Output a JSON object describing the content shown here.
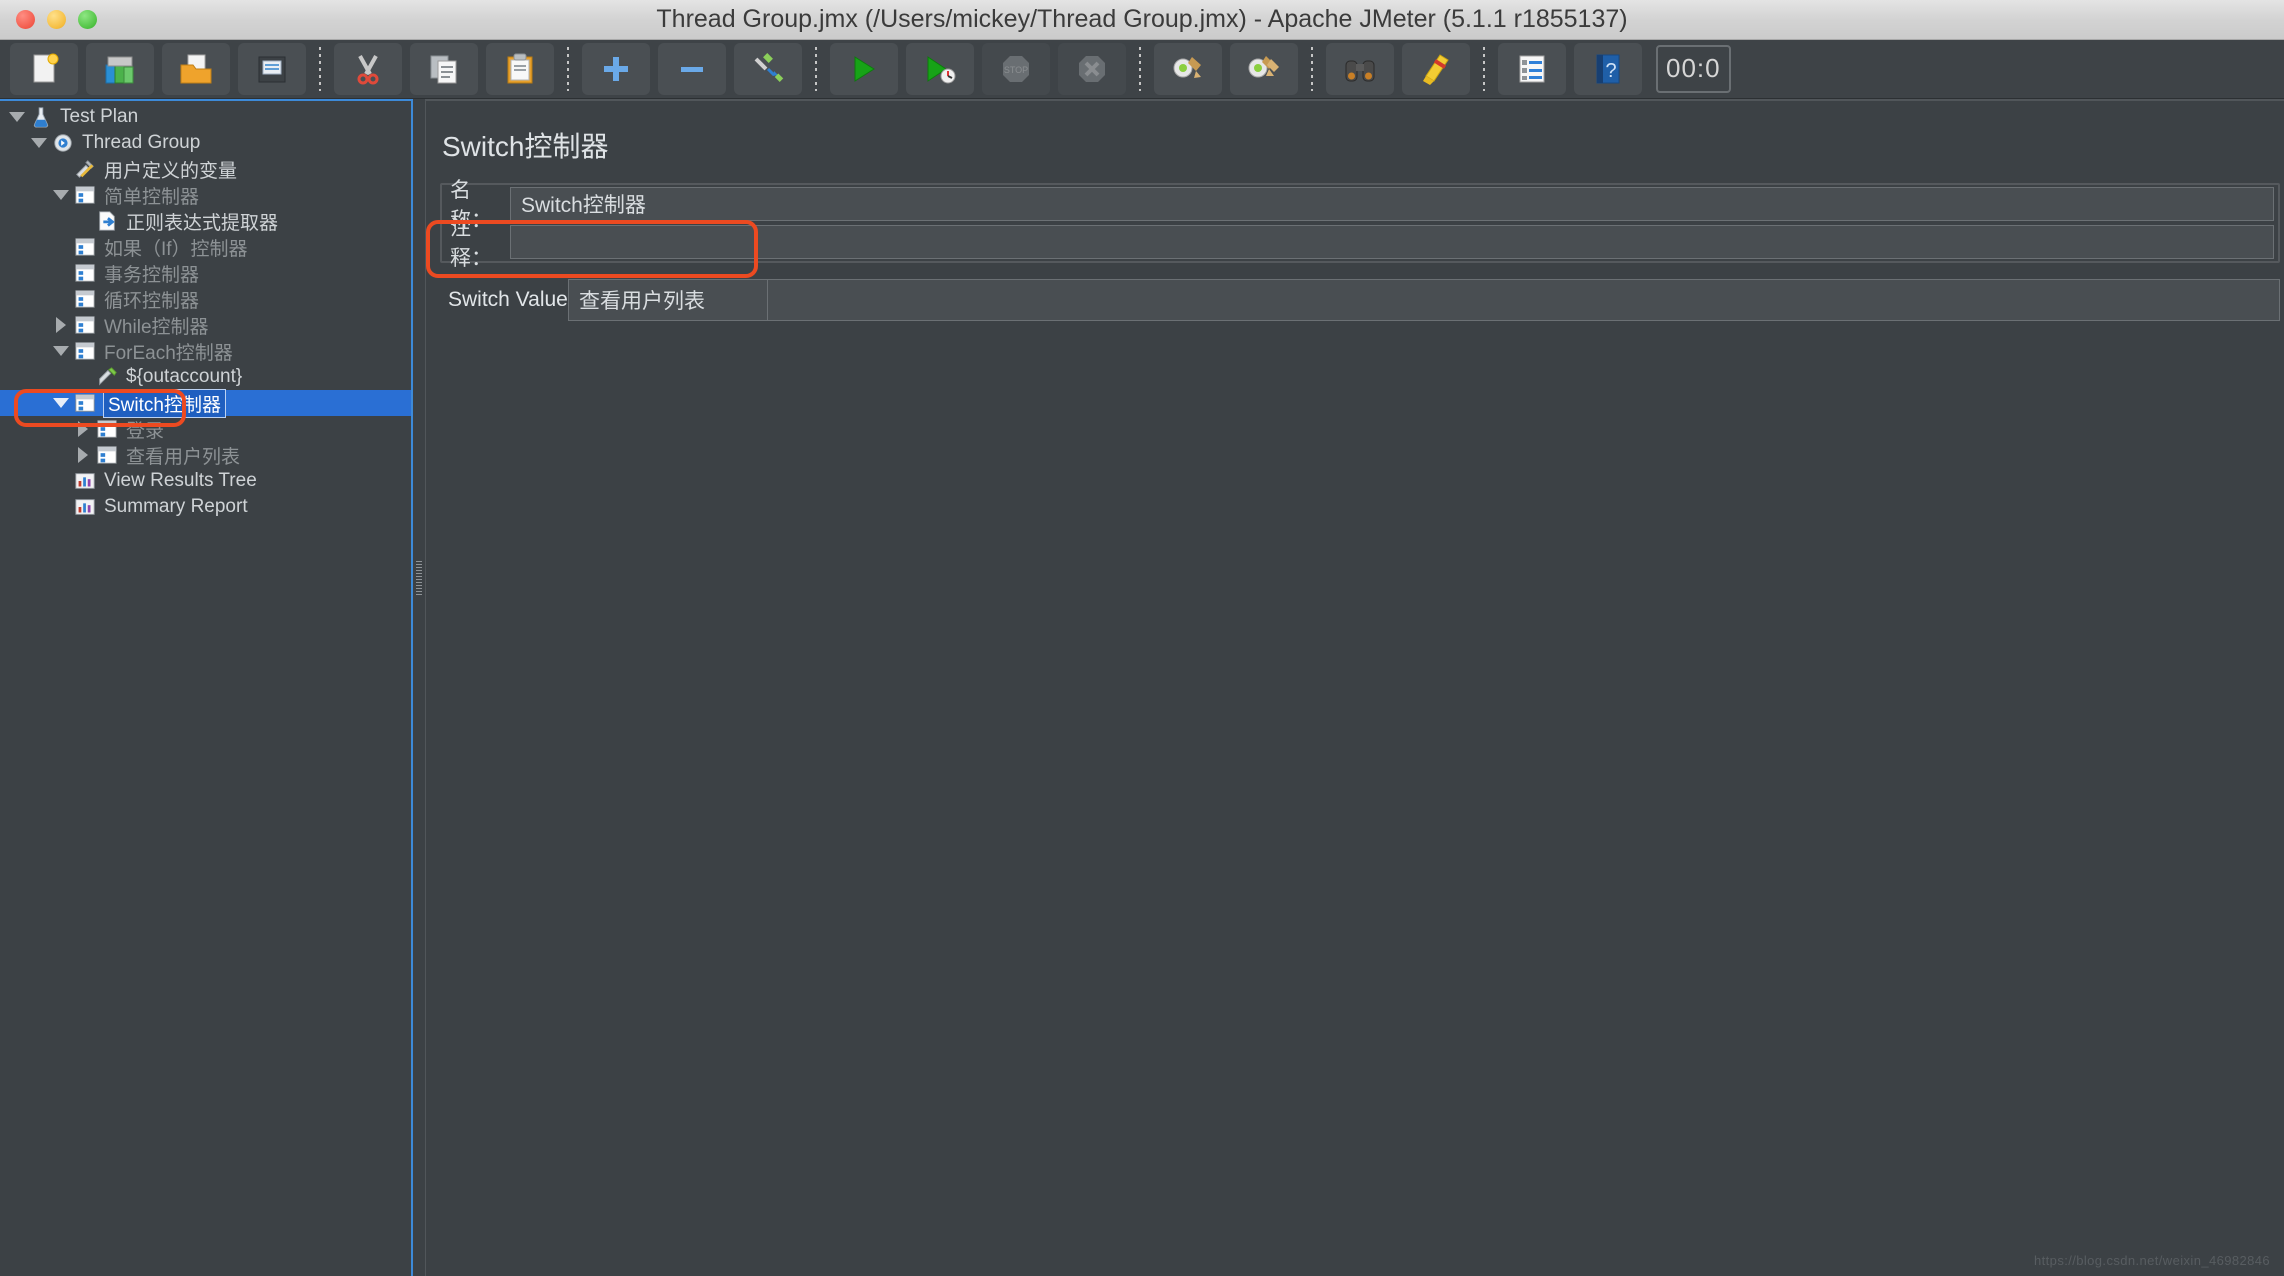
{
  "window": {
    "title": "Thread Group.jmx (/Users/mickey/Thread Group.jmx) - Apache JMeter (5.1.1 r1855137)",
    "controls": {
      "close": "close",
      "minimize": "minimize",
      "maximize": "maximize"
    }
  },
  "toolbar": {
    "timer": "00:0",
    "buttons": [
      {
        "name": "new-button",
        "icon": "new-file-icon",
        "disabled": false
      },
      {
        "name": "templates-button",
        "icon": "templates-icon",
        "disabled": false
      },
      {
        "name": "open-button",
        "icon": "open-folder-icon",
        "disabled": false
      },
      {
        "name": "save-button",
        "icon": "save-disk-icon",
        "disabled": false
      },
      {
        "name": "separator-1",
        "icon": "separator",
        "disabled": false
      },
      {
        "name": "cut-button",
        "icon": "scissors-icon",
        "disabled": false
      },
      {
        "name": "copy-button",
        "icon": "copy-icon",
        "disabled": false
      },
      {
        "name": "paste-button",
        "icon": "clipboard-icon",
        "disabled": false
      },
      {
        "name": "separator-2",
        "icon": "separator",
        "disabled": false
      },
      {
        "name": "expand-all-button",
        "icon": "plus-icon",
        "disabled": false
      },
      {
        "name": "collapse-all-button",
        "icon": "minus-icon",
        "disabled": false
      },
      {
        "name": "toggle-button",
        "icon": "toggle-pencil-icon",
        "disabled": false
      },
      {
        "name": "separator-3",
        "icon": "separator",
        "disabled": false
      },
      {
        "name": "start-button",
        "icon": "play-green-icon",
        "disabled": false
      },
      {
        "name": "start-no-pause-button",
        "icon": "play-nopause-icon",
        "disabled": false
      },
      {
        "name": "stop-button",
        "icon": "stop-icon",
        "disabled": true
      },
      {
        "name": "shutdown-button",
        "icon": "shutdown-x-icon",
        "disabled": true
      },
      {
        "name": "separator-4",
        "icon": "separator",
        "disabled": false
      },
      {
        "name": "clear-button",
        "icon": "gear-broom-icon",
        "disabled": false
      },
      {
        "name": "clear-all-button",
        "icon": "gear-brooms-icon",
        "disabled": false
      },
      {
        "name": "separator-5",
        "icon": "separator",
        "disabled": false
      },
      {
        "name": "search-button",
        "icon": "binoculars-icon",
        "disabled": false
      },
      {
        "name": "reset-search-button",
        "icon": "broom-yellow-icon",
        "disabled": false
      },
      {
        "name": "separator-6",
        "icon": "separator",
        "disabled": false
      },
      {
        "name": "function-helper-button",
        "icon": "function-list-icon",
        "disabled": false
      },
      {
        "name": "help-button",
        "icon": "help-book-icon",
        "disabled": false
      }
    ]
  },
  "tree": {
    "nodes": [
      {
        "label": "Test Plan",
        "indent": 0,
        "twisty": "down",
        "icon": "test-plan-icon",
        "dim": false,
        "selected": false
      },
      {
        "label": "Thread Group",
        "indent": 1,
        "twisty": "down",
        "icon": "thread-group-icon",
        "dim": false,
        "selected": false
      },
      {
        "label": "用户定义的变量",
        "indent": 2,
        "twisty": "none",
        "icon": "user-vars-icon",
        "dim": false,
        "selected": false
      },
      {
        "label": "简单控制器",
        "indent": 2,
        "twisty": "down",
        "icon": "controller-icon",
        "dim": true,
        "selected": false
      },
      {
        "label": "正则表达式提取器",
        "indent": 3,
        "twisty": "none",
        "icon": "extractor-icon",
        "dim": false,
        "selected": false
      },
      {
        "label": "如果（If）控制器",
        "indent": 2,
        "twisty": "none",
        "icon": "controller-icon",
        "dim": true,
        "selected": false
      },
      {
        "label": "事务控制器",
        "indent": 2,
        "twisty": "none",
        "icon": "controller-icon",
        "dim": true,
        "selected": false
      },
      {
        "label": "循环控制器",
        "indent": 2,
        "twisty": "none",
        "icon": "controller-icon",
        "dim": true,
        "selected": false
      },
      {
        "label": "While控制器",
        "indent": 2,
        "twisty": "right",
        "icon": "controller-icon",
        "dim": true,
        "selected": false
      },
      {
        "label": "ForEach控制器",
        "indent": 2,
        "twisty": "down",
        "icon": "controller-icon",
        "dim": true,
        "selected": false
      },
      {
        "label": "${outaccount}",
        "indent": 3,
        "twisty": "none",
        "icon": "sampler-icon",
        "dim": false,
        "selected": false
      },
      {
        "label": "Switch控制器",
        "indent": 2,
        "twisty": "down",
        "icon": "controller-icon",
        "dim": false,
        "selected": true
      },
      {
        "label": "登录",
        "indent": 3,
        "twisty": "right",
        "icon": "controller-icon",
        "dim": true,
        "selected": false
      },
      {
        "label": "查看用户列表",
        "indent": 3,
        "twisty": "right",
        "icon": "controller-icon",
        "dim": true,
        "selected": false
      },
      {
        "label": "View Results Tree",
        "indent": 2,
        "twisty": "none",
        "icon": "listener-icon",
        "dim": false,
        "selected": false
      },
      {
        "label": "Summary Report",
        "indent": 2,
        "twisty": "none",
        "icon": "listener-icon",
        "dim": false,
        "selected": false
      }
    ]
  },
  "detail": {
    "title": "Switch控制器",
    "name_label": "名称：",
    "name_value": "Switch控制器",
    "comment_label": "注释：",
    "comment_value": "",
    "switch_value_label": "Switch Value",
    "switch_value": "查看用户列表"
  },
  "watermark": {
    "text": "https://blog.csdn.net/weixin_46982846"
  },
  "colors": {
    "accent_selection": "#2a6fd4",
    "annotation_red": "#ec4a21",
    "pane_bg": "#3c4145",
    "toolbar_bg": "#3e4347",
    "split_border": "#3d8ad8"
  }
}
